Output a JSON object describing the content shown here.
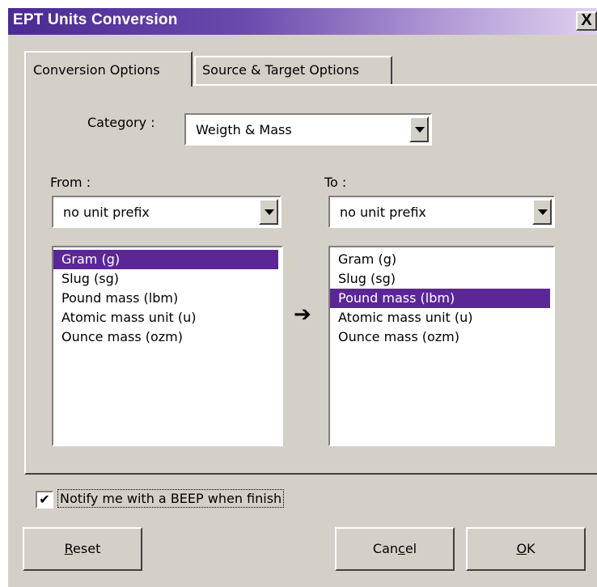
{
  "window": {
    "title": "EPT Units Conversion",
    "close_symbol": "X"
  },
  "tabs": [
    {
      "label": "Conversion Options",
      "active": true
    },
    {
      "label": "Source & Target Options",
      "active": false
    }
  ],
  "category": {
    "label": "Category :",
    "value": "Weigth & Mass"
  },
  "from": {
    "label": "From :",
    "prefix_value": "no unit prefix",
    "units": [
      "Gram (g)",
      "Slug (sg)",
      "Pound mass (lbm)",
      "Atomic mass unit (u)",
      "Ounce mass (ozm)"
    ],
    "selected_index": 0
  },
  "to": {
    "label": "To :",
    "prefix_value": "no unit prefix",
    "units": [
      "Gram (g)",
      "Slug (sg)",
      "Pound mass (lbm)",
      "Atomic mass unit (u)",
      "Ounce mass (ozm)"
    ],
    "selected_index": 2
  },
  "arrow_symbol": "➔",
  "notify": {
    "label": "Notify me with a BEEP when finish",
    "checked": true,
    "check_symbol": "✔"
  },
  "buttons": {
    "reset": {
      "pre": "",
      "mnemonic": "R",
      "post": "eset"
    },
    "cancel": {
      "pre": "Can",
      "mnemonic": "c",
      "post": "el"
    },
    "ok": {
      "pre": "",
      "mnemonic": "O",
      "post": "K"
    }
  },
  "colors": {
    "selection": "#5b2797",
    "title_start": "#4a2a93",
    "face": "#d4d0c8"
  }
}
